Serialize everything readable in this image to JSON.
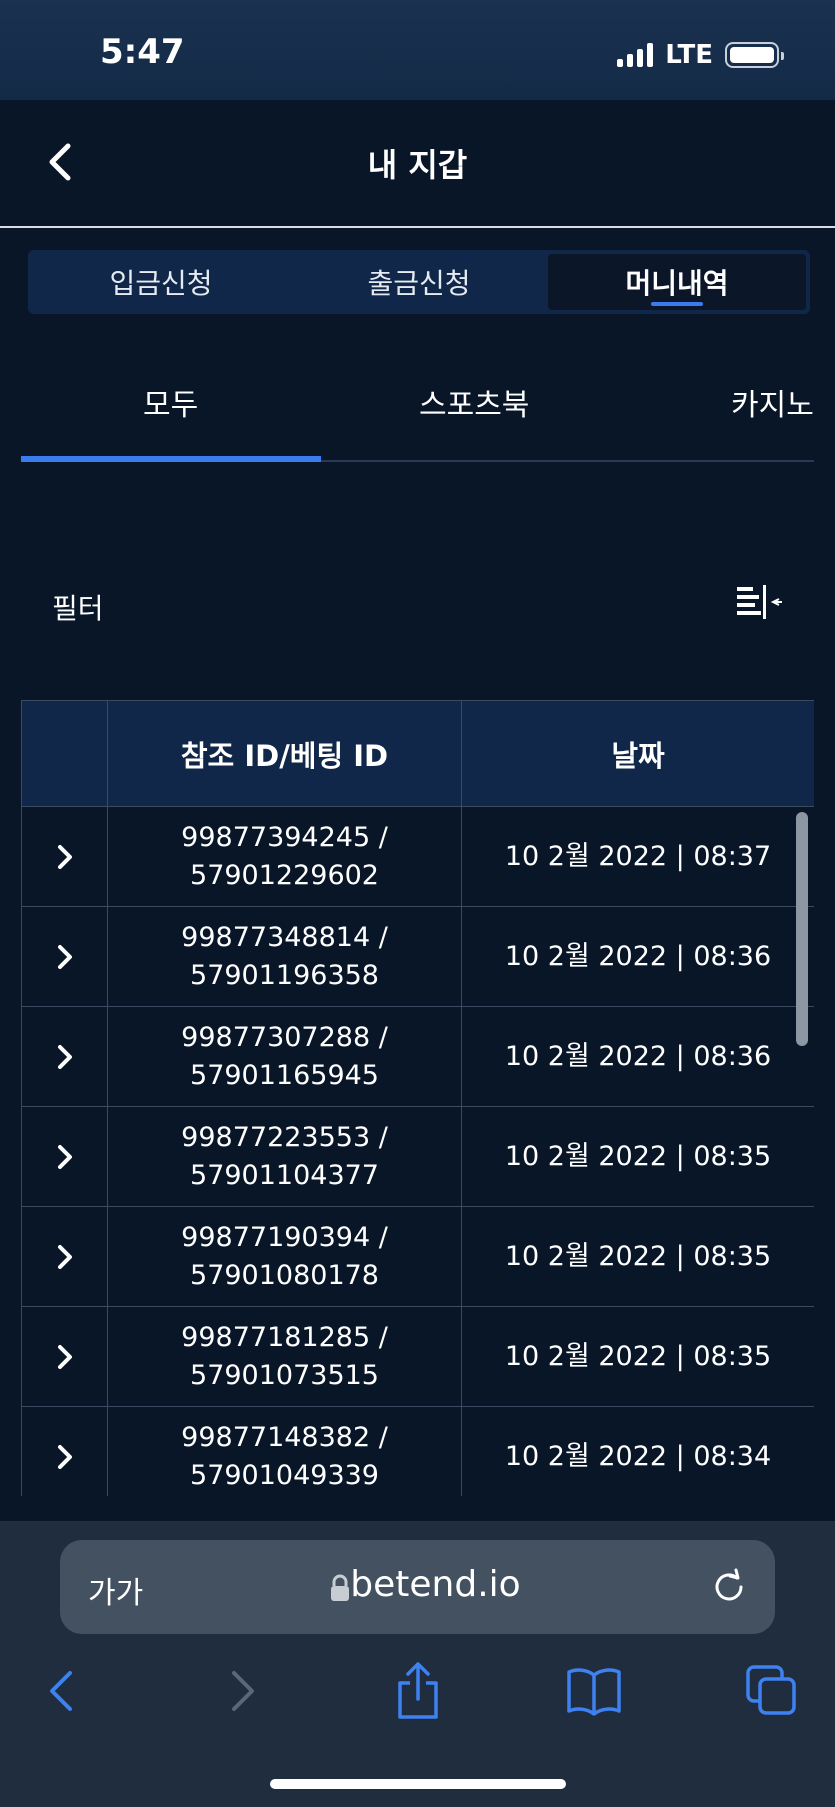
{
  "status": {
    "time": "5:47",
    "network": "LTE"
  },
  "header": {
    "title": "내 지갑"
  },
  "segments": [
    {
      "label": "입금신청",
      "active": false
    },
    {
      "label": "출금신청",
      "active": false
    },
    {
      "label": "머니내역",
      "active": true
    }
  ],
  "sub_tabs": [
    {
      "label": "모두",
      "active": true
    },
    {
      "label": "스포츠북",
      "active": false
    },
    {
      "label": "카지노",
      "active": false
    }
  ],
  "filter": {
    "label": "필터"
  },
  "table": {
    "headers": [
      "",
      "참조 ID/베팅 ID",
      "날짜"
    ],
    "rows": [
      {
        "ref_id": "99877394245 /",
        "bet_id": "57901229602",
        "date": "10 2월 2022 | 08:37"
      },
      {
        "ref_id": "99877348814 /",
        "bet_id": "57901196358",
        "date": "10 2월 2022 | 08:36"
      },
      {
        "ref_id": "99877307288 /",
        "bet_id": "57901165945",
        "date": "10 2월 2022 | 08:36"
      },
      {
        "ref_id": "99877223553 /",
        "bet_id": "57901104377",
        "date": "10 2월 2022 | 08:35"
      },
      {
        "ref_id": "99877190394 /",
        "bet_id": "57901080178",
        "date": "10 2월 2022 | 08:35"
      },
      {
        "ref_id": "99877181285 /",
        "bet_id": "57901073515",
        "date": "10 2월 2022 | 08:35"
      },
      {
        "ref_id": "99877148382 /",
        "bet_id": "57901049339",
        "date": "10 2월 2022 | 08:34"
      }
    ]
  },
  "browser": {
    "text_size_label": "가가",
    "url": "betend.io"
  },
  "colors": {
    "background": "#091628",
    "accent": "#3a7bf0",
    "header_cell": "#10274a"
  }
}
